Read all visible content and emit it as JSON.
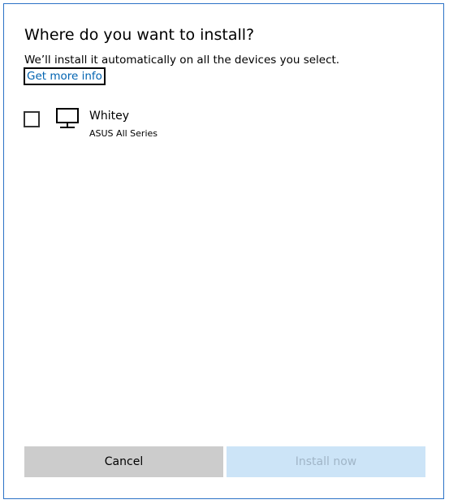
{
  "dialog": {
    "title": "Where do you want to install?",
    "subtitle": "We’ll install it automatically on all the devices you select.",
    "more_info_link": "Get more info"
  },
  "devices": [
    {
      "name": "Whitey",
      "model": "ASUS All Series",
      "checked": false,
      "icon": "desktop-pc-icon"
    }
  ],
  "buttons": {
    "cancel_label": "Cancel",
    "install_label": "Install now",
    "install_enabled": false
  },
  "colors": {
    "accent_border": "#2b72c6",
    "link": "#0063b1",
    "cancel_bg": "#cccccc",
    "install_bg_disabled": "#cce4f7",
    "install_text_disabled": "#a0b5c7"
  }
}
